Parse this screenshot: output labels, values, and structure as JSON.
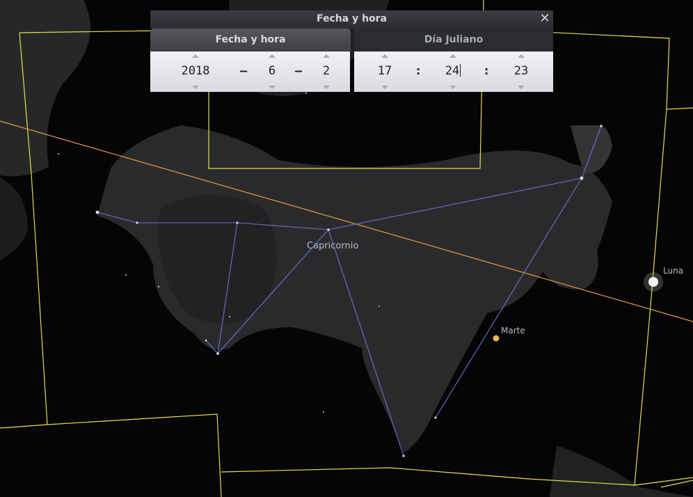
{
  "window": {
    "title": "Fecha y hora",
    "close_icon": "close-icon"
  },
  "tabs": {
    "date_label": "Fecha y hora",
    "julian_label": "Día Juliano"
  },
  "date": {
    "year": "2018",
    "month": "6",
    "day": "2",
    "separator": "–"
  },
  "time": {
    "hour": "17",
    "minute": "24",
    "second": "23",
    "separator": ":"
  },
  "sky": {
    "constellation": "Capricornio",
    "planet": "Marte",
    "moon": "Luna"
  },
  "colors": {
    "constellation_lines": "#6c73c8",
    "boundaries": "#e2e24a",
    "ecliptic": "#e0a040",
    "planet_mars": "#f2b24e"
  }
}
